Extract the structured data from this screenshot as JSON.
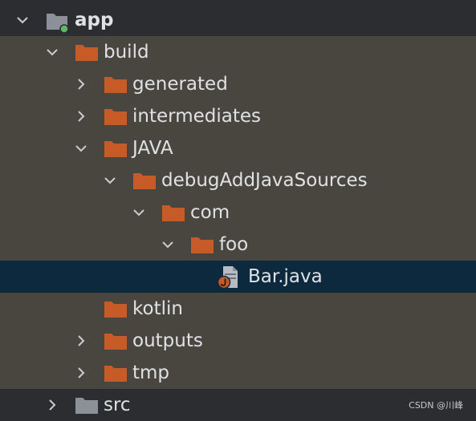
{
  "project_tree": {
    "items": [
      {
        "label": "app"
      },
      {
        "label": "build"
      },
      {
        "label": "generated"
      },
      {
        "label": "intermediates"
      },
      {
        "label": "JAVA"
      },
      {
        "label": "debugAddJavaSources"
      },
      {
        "label": "com"
      },
      {
        "label": "foo"
      },
      {
        "label": "Bar.java"
      },
      {
        "label": "kotlin"
      },
      {
        "label": "outputs"
      },
      {
        "label": "tmp"
      },
      {
        "label": "src"
      }
    ]
  },
  "watermark": "CSDN @川峰",
  "colors": {
    "folder_orange": "#c75b28",
    "folder_gray": "#8c9199",
    "selection": "#0d293e",
    "excluded_row": "#49463f"
  }
}
